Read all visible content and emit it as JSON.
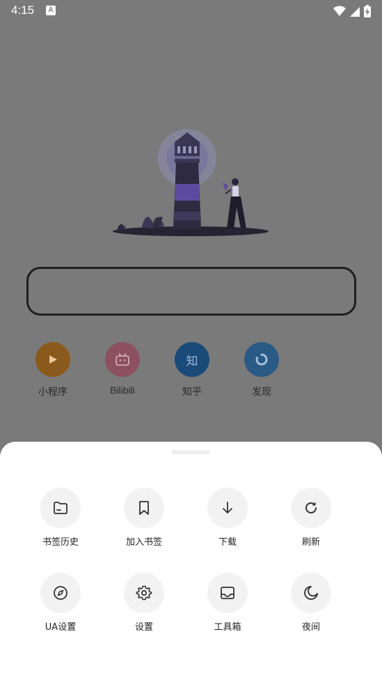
{
  "status_bar": {
    "time": "4:15",
    "notification_icon": "a-icon",
    "icons": [
      "wifi-icon",
      "signal-icon",
      "battery-charging-icon"
    ]
  },
  "search": {
    "placeholder": ""
  },
  "shortcuts": [
    {
      "label": "小程序",
      "icon": "play-icon",
      "color": "#8a5a1c"
    },
    {
      "label": "Bilibili",
      "icon": "tv-icon",
      "color": "#8c5060"
    },
    {
      "label": "知乎",
      "icon": "zhihu-icon",
      "icon_text": "知",
      "color": "#1a4a78"
    },
    {
      "label": "发现",
      "icon": "loading-ring-icon",
      "color": "#2a5a86"
    }
  ],
  "menu": {
    "rows": [
      [
        {
          "label": "书签历史",
          "icon": "folder-icon"
        },
        {
          "label": "加入书签",
          "icon": "bookmark-icon"
        },
        {
          "label": "下载",
          "icon": "arrow-down-icon"
        },
        {
          "label": "刷新",
          "icon": "refresh-icon"
        }
      ],
      [
        {
          "label": "UA设置",
          "icon": "compass-icon"
        },
        {
          "label": "设置",
          "icon": "gear-icon"
        },
        {
          "label": "工具箱",
          "icon": "inbox-tray-icon"
        },
        {
          "label": "夜间",
          "icon": "moon-icon"
        }
      ]
    ]
  },
  "colors": {
    "overlay_background": "#7a7a7a",
    "sheet_background": "#ffffff",
    "icon_circle": "#f2f2f2",
    "accent_purple": "#5b4aa0"
  }
}
